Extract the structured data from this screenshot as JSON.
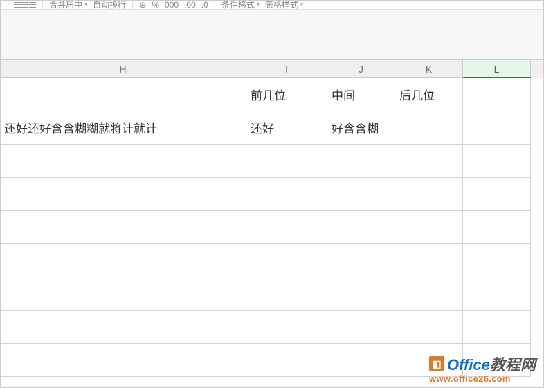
{
  "ribbon": {
    "merge_center": "合并居中",
    "auto_wrap": "自动换行",
    "percent": "%",
    "thousands": "000",
    "dec_inc": ".00",
    "dec_dec": ".0",
    "cond_format": "条件格式",
    "table_style": "表格样式"
  },
  "columns": {
    "H": "H",
    "I": "I",
    "J": "J",
    "K": "K",
    "L": "L"
  },
  "active_column": "L",
  "cells": {
    "row1": {
      "H": "",
      "I": "前几位",
      "J": "中间",
      "K": "后几位",
      "L": ""
    },
    "row2": {
      "H": "还好还好含含糊糊就将计就计",
      "I": "还好",
      "J": "好含含糊",
      "K": "",
      "L": ""
    },
    "row3": {
      "H": "",
      "I": "",
      "J": "",
      "K": "",
      "L": ""
    },
    "row4": {
      "H": "",
      "I": "",
      "J": "",
      "K": "",
      "L": ""
    },
    "row5": {
      "H": "",
      "I": "",
      "J": "",
      "K": "",
      "L": ""
    },
    "row6": {
      "H": "",
      "I": "",
      "J": "",
      "K": "",
      "L": ""
    },
    "row7": {
      "H": "",
      "I": "",
      "J": "",
      "K": "",
      "L": ""
    },
    "row8": {
      "H": "",
      "I": "",
      "J": "",
      "K": "",
      "L": ""
    },
    "row9": {
      "H": "",
      "I": "",
      "J": "",
      "K": "",
      "L": ""
    }
  },
  "watermark": {
    "brand1": "Office",
    "brand2": "教程网",
    "url": "www.office26.com"
  }
}
